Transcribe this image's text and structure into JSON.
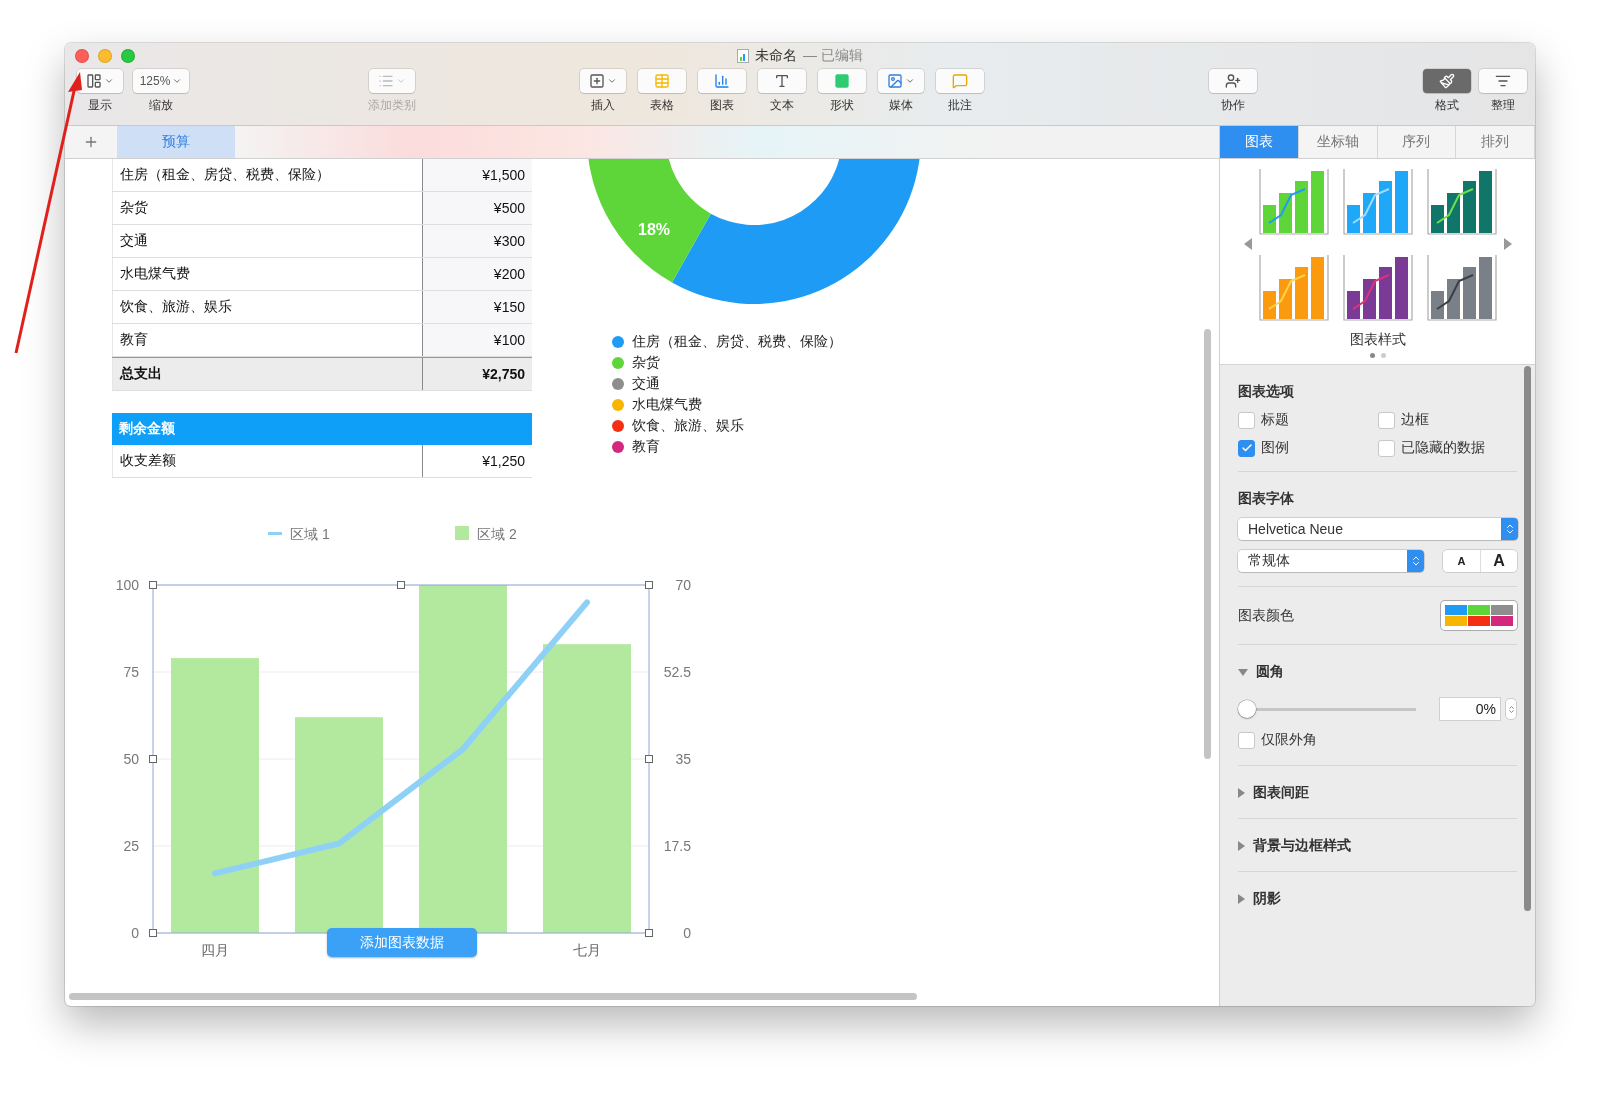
{
  "window": {
    "title": "未命名",
    "title_status": "— 已编辑"
  },
  "toolbar": {
    "groups": [
      [
        {
          "kind": "view",
          "label": "显示",
          "disabled": false
        },
        {
          "kind": "zoom",
          "label": "缩放",
          "value": "125%",
          "disabled": false
        }
      ],
      [
        {
          "kind": "category",
          "label": "添加类别",
          "disabled": true
        }
      ],
      [
        {
          "kind": "insert",
          "label": "插入",
          "disabled": false
        },
        {
          "kind": "table",
          "label": "表格",
          "disabled": false
        },
        {
          "kind": "chart",
          "label": "图表",
          "disabled": false
        },
        {
          "kind": "text",
          "label": "文本",
          "disabled": false
        },
        {
          "kind": "shape",
          "label": "形状",
          "disabled": false
        },
        {
          "kind": "media",
          "label": "媒体",
          "disabled": false
        },
        {
          "kind": "comment",
          "label": "批注",
          "disabled": false
        }
      ],
      [
        {
          "kind": "collaborate",
          "label": "协作",
          "disabled": false
        }
      ],
      [
        {
          "kind": "format",
          "label": "格式",
          "disabled": false,
          "selected": true
        },
        {
          "kind": "organize",
          "label": "整理",
          "disabled": false,
          "selected": false
        }
      ]
    ]
  },
  "sheet_tabs": [
    {
      "label": "预算",
      "selected": true
    }
  ],
  "expense_table": {
    "rows": [
      {
        "name": "住房（租金、房贷、税费、保险）",
        "amount": "¥1,500"
      },
      {
        "name": "杂货",
        "amount": "¥500"
      },
      {
        "name": "交通",
        "amount": "¥300"
      },
      {
        "name": "水电煤气费",
        "amount": "¥200"
      },
      {
        "name": "饮食、旅游、娱乐",
        "amount": "¥150"
      },
      {
        "name": "教育",
        "amount": "¥100"
      }
    ],
    "total": {
      "name": "总支出",
      "amount": "¥2,750"
    }
  },
  "balance_table": {
    "header": "剩余金额",
    "rows": [
      {
        "name": "收支差额",
        "amount": "¥1,250"
      }
    ]
  },
  "donut": {
    "slice_label": "18%",
    "legend": [
      {
        "label": "住房（租金、房贷、税费、保险）",
        "color": "#1e9cf5"
      },
      {
        "label": "杂货",
        "color": "#5ed63a"
      },
      {
        "label": "交通",
        "color": "#8e8e8e"
      },
      {
        "label": "水电煤气费",
        "color": "#f7b500"
      },
      {
        "label": "饮食、旅游、娱乐",
        "color": "#f52f14"
      },
      {
        "label": "教育",
        "color": "#d3287e"
      }
    ]
  },
  "combo_chart": {
    "button": "添加图表数据",
    "bar_chart": {
      "chart_data": {
        "type": "bar",
        "categories": [
          "四月",
          null,
          null,
          "七月"
        ],
        "ylim": [
          0,
          100
        ],
        "yticks": [
          0,
          25,
          50,
          75,
          100
        ],
        "grid": true,
        "series": [
          {
            "name": "区域 2",
            "color": "#b3e99f",
            "values": [
              79,
              62,
              100,
              83
            ]
          }
        ]
      }
    },
    "line_chart": {
      "chart_data": {
        "type": "line",
        "categories": [
          null,
          null,
          null,
          null
        ],
        "ylim": [
          0,
          70
        ],
        "yticks": [
          0,
          17.5,
          35,
          52.5,
          70
        ],
        "series": [
          {
            "name": "区域 1",
            "color": "#8fd0f7",
            "values": [
              12,
              18,
              37,
              66.5
            ]
          }
        ]
      }
    }
  },
  "panel": {
    "tabs": [
      {
        "label": "图表",
        "selected": true
      },
      {
        "label": "坐标轴",
        "selected": false
      },
      {
        "label": "序列",
        "selected": false
      },
      {
        "label": "排列",
        "selected": false
      }
    ],
    "chart_styles": [
      {
        "color": "#5ed63a",
        "line": {
          "color": "#1e9cf5"
        }
      },
      {
        "color": "#1ea8f7",
        "line": {
          "color": "#9fdcff"
        }
      },
      {
        "color": "#10766a",
        "line": {
          "color": "#6be04a"
        }
      },
      {
        "color": "#fb9a0e",
        "line": {
          "color": "#ffd24a"
        }
      },
      {
        "color": "#7a3a96",
        "line": {
          "color": "#e0307c"
        }
      },
      {
        "color": "#7a8088",
        "line": {
          "color": "#3b3e44"
        }
      }
    ],
    "styles_label": "图表样式",
    "options_title": "图表选项",
    "options": [
      {
        "label": "标题",
        "checked": false
      },
      {
        "label": "边框",
        "checked": false
      },
      {
        "label": "图例",
        "checked": true
      },
      {
        "label": "已隐藏的数据",
        "checked": false
      }
    ],
    "font_title": "图表字体",
    "font_family": "Helvetica Neue",
    "font_style": "常规体",
    "font_smaller": "A",
    "font_larger": "A",
    "color_title": "图表颜色",
    "colors": [
      {
        "color": "#1e9cf5"
      },
      {
        "color": "#5ed63a"
      },
      {
        "color": "#8e8e8e"
      },
      {
        "color": "#f7b500"
      },
      {
        "color": "#f52f14"
      },
      {
        "color": "#d3287e"
      }
    ],
    "corner": {
      "title": "圆角",
      "expanded": true,
      "level": 0,
      "value": "0%",
      "outer_only": {
        "label": "仅限外角",
        "checked": false
      }
    },
    "sections": [
      {
        "title": "图表间距",
        "expanded": false
      },
      {
        "title": "背景与边框样式",
        "expanded": false
      },
      {
        "title": "阴影",
        "expanded": false
      }
    ]
  }
}
